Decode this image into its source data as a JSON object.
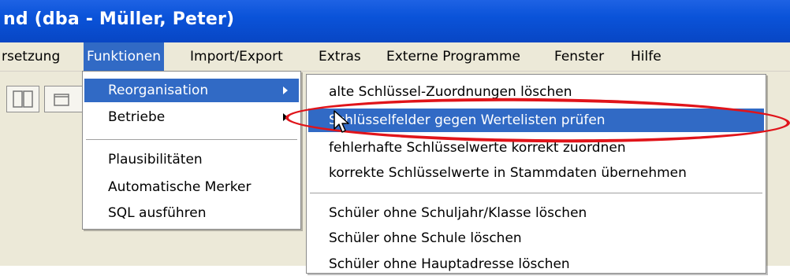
{
  "window": {
    "title": "nd (dba - Müller, Peter)"
  },
  "menubar": {
    "items": [
      "rsetzung",
      "Funktionen",
      "Import/Export",
      "Extras",
      "Externe Programme",
      "Fenster",
      "Hilfe"
    ]
  },
  "funktionen_menu": {
    "items": [
      "Reorganisation",
      "Betriebe",
      "Plausibilitäten",
      "Automatische Merker",
      "SQL ausführen"
    ]
  },
  "reorganisation_submenu": {
    "items": [
      "alte Schlüssel-Zuordnungen löschen",
      "Schlüsselfelder gegen Wertelisten prüfen",
      "fehlerhafte Schlüsselwerte korrekt zuordnen",
      "korrekte Schlüsselwerte in Stammdaten übernehmen",
      "Schüler ohne Schuljahr/Klasse löschen",
      "Schüler ohne Schule löschen",
      "Schüler ohne Hauptadresse löschen"
    ]
  },
  "colors": {
    "highlight": "#316ac5",
    "annotation": "#e0141a",
    "titlebar": "#0a53d9"
  },
  "icons": [
    "toolbar-pane-icon",
    "toolbar-window-icon",
    "mouse-pointer-icon"
  ]
}
